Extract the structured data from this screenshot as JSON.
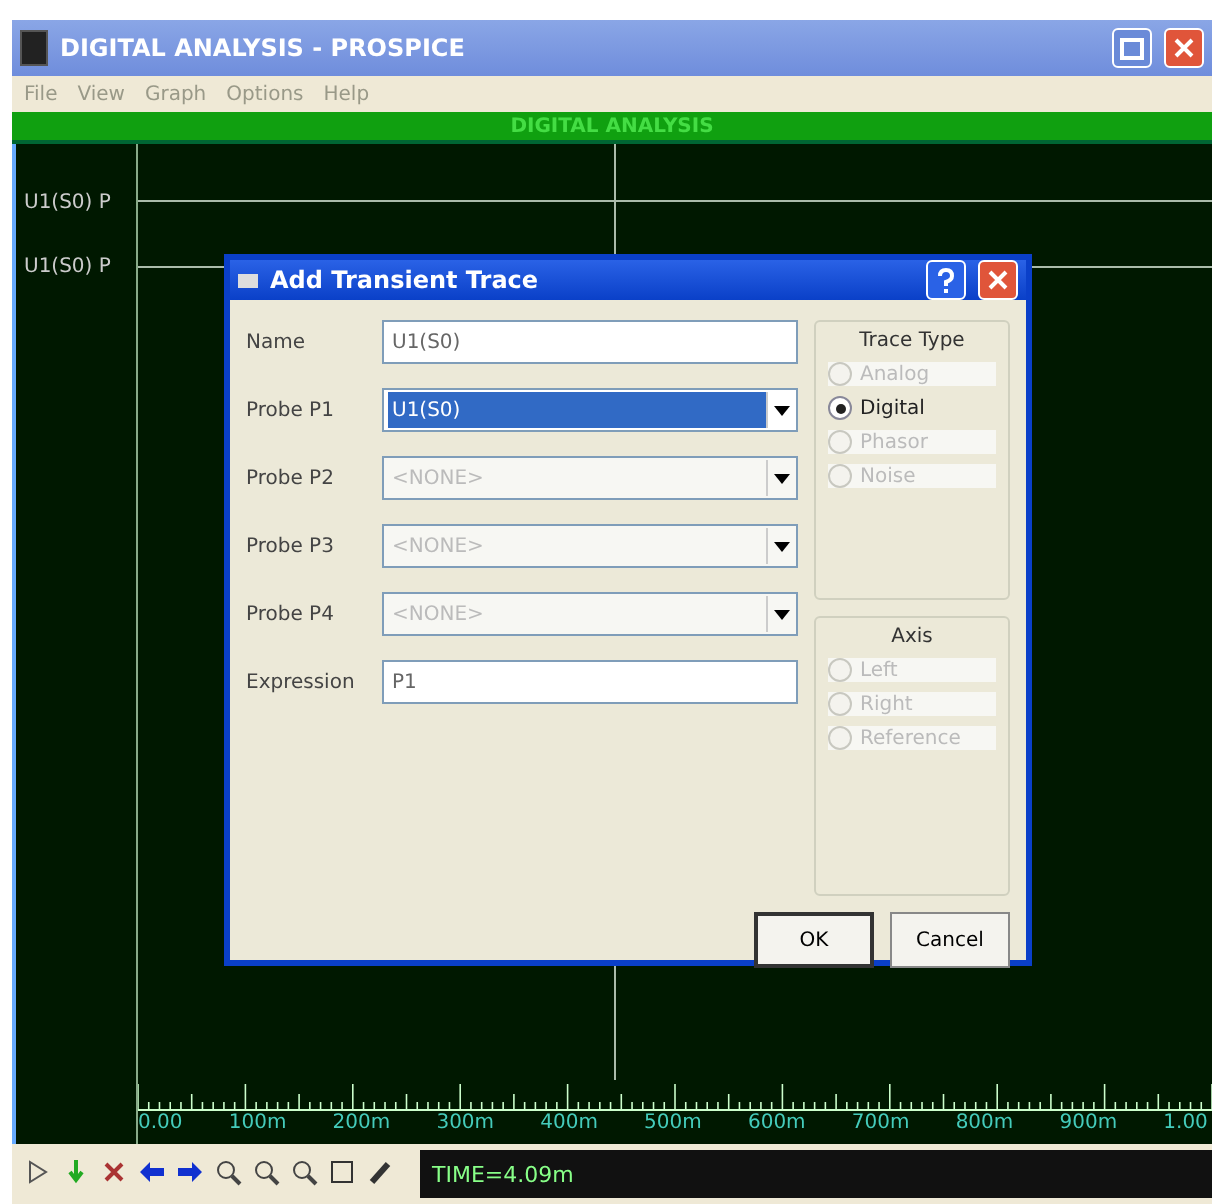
{
  "window": {
    "title": "DIGITAL ANALYSIS - PROSPICE"
  },
  "menu": [
    "File",
    "View",
    "Graph",
    "Options",
    "Help"
  ],
  "graph": {
    "title": "DIGITAL ANALYSIS",
    "traces": [
      "U1(S0) P",
      "U1(S0) P"
    ],
    "axis_labels": [
      "0.00",
      "100m",
      "200m",
      "300m",
      "400m",
      "500m",
      "600m",
      "700m",
      "800m",
      "900m",
      "1.00"
    ]
  },
  "dialog": {
    "title": "Add Transient Trace",
    "fields": [
      {
        "label": "Name",
        "value": "U1(S0)",
        "kind": "text",
        "selected": false,
        "disabled": false
      },
      {
        "label": "Probe P1",
        "value": "U1(S0)",
        "kind": "combo",
        "selected": true,
        "disabled": false
      },
      {
        "label": "Probe P2",
        "value": "<NONE>",
        "kind": "combo",
        "selected": false,
        "disabled": true
      },
      {
        "label": "Probe P3",
        "value": "<NONE>",
        "kind": "combo",
        "selected": false,
        "disabled": true
      },
      {
        "label": "Probe P4",
        "value": "<NONE>",
        "kind": "combo",
        "selected": false,
        "disabled": true
      },
      {
        "label": "Expression",
        "value": "P1",
        "kind": "text",
        "selected": false,
        "disabled": false
      }
    ],
    "trace_type": {
      "title": "Trace Type",
      "options": [
        {
          "label": "Analog",
          "selected": false,
          "disabled": true
        },
        {
          "label": "Digital",
          "selected": true,
          "disabled": false
        },
        {
          "label": "Phasor",
          "selected": false,
          "disabled": true
        },
        {
          "label": "Noise",
          "selected": false,
          "disabled": true
        }
      ]
    },
    "axis": {
      "title": "Axis",
      "options": [
        {
          "label": "Left",
          "selected": false,
          "disabled": true
        },
        {
          "label": "Right",
          "selected": false,
          "disabled": true
        },
        {
          "label": "Reference",
          "selected": false,
          "disabled": true
        }
      ]
    },
    "buttons": [
      "OK",
      "Cancel"
    ]
  },
  "status": {
    "time": "TIME=4.09m"
  }
}
